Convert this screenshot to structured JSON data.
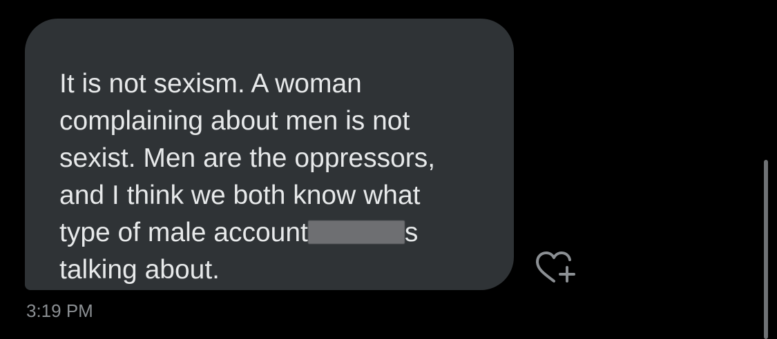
{
  "message": {
    "line1": "It is not sexism. A woman",
    "line2": "complaining about men is not",
    "line3": "sexist. Men are the oppressors,",
    "line4": "and I think we both know what",
    "line5_before": "type of male account",
    "line5_after": "s",
    "line6": "talking about."
  },
  "timestamp": "3:19 PM",
  "icons": {
    "react": "heart-plus-icon"
  },
  "colors": {
    "background": "#000000",
    "bubble": "#2f3336",
    "text": "#e7e9ea",
    "timestamp": "#8b8f93"
  }
}
